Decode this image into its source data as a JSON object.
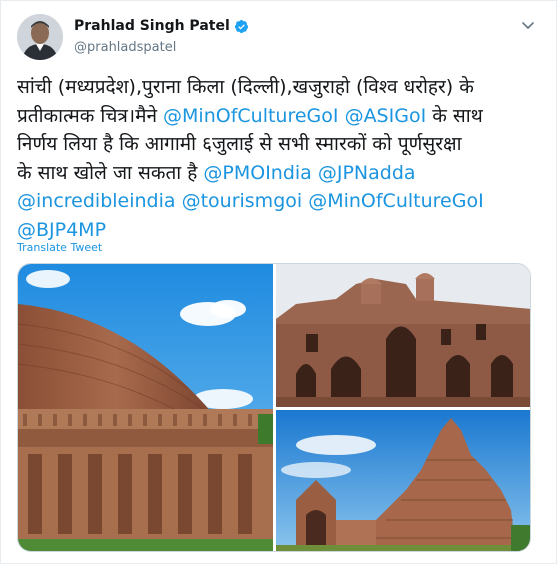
{
  "tweet": {
    "author_name": "Prahlad Singh Patel",
    "author_handle": "@prahladspatel",
    "text_lines": [
      "सांची (मध्यप्रदेश),पुराना किला (दिल्ली),खजुराहो (विश्व धरोहर) के",
      "प्रतीकात्मक चित्र।मैने ",
      "@MinOfCultureGoI",
      " ",
      "@ASIGoI",
      " के साथ",
      "निर्णय लिया है कि आगामी ६जुलाई से सभी स्मारकों को पूर्णसुरक्षा",
      "के साथ खोले जा सकता है ",
      "@PMOIndia",
      " ",
      "@JPNadda",
      "@incredibleindia",
      " ",
      "@tourismgoi",
      " ",
      "@MinOfCultureGoI",
      "@BJP4MP"
    ],
    "translate_label": "Translate Tweet"
  },
  "icons": {
    "verified": "verified-badge-icon",
    "menu": "chevron-down-icon"
  },
  "colors": {
    "link": "#1b95e0",
    "text": "#14171a",
    "secondary": "#657786",
    "verified": "#1da1f2"
  }
}
